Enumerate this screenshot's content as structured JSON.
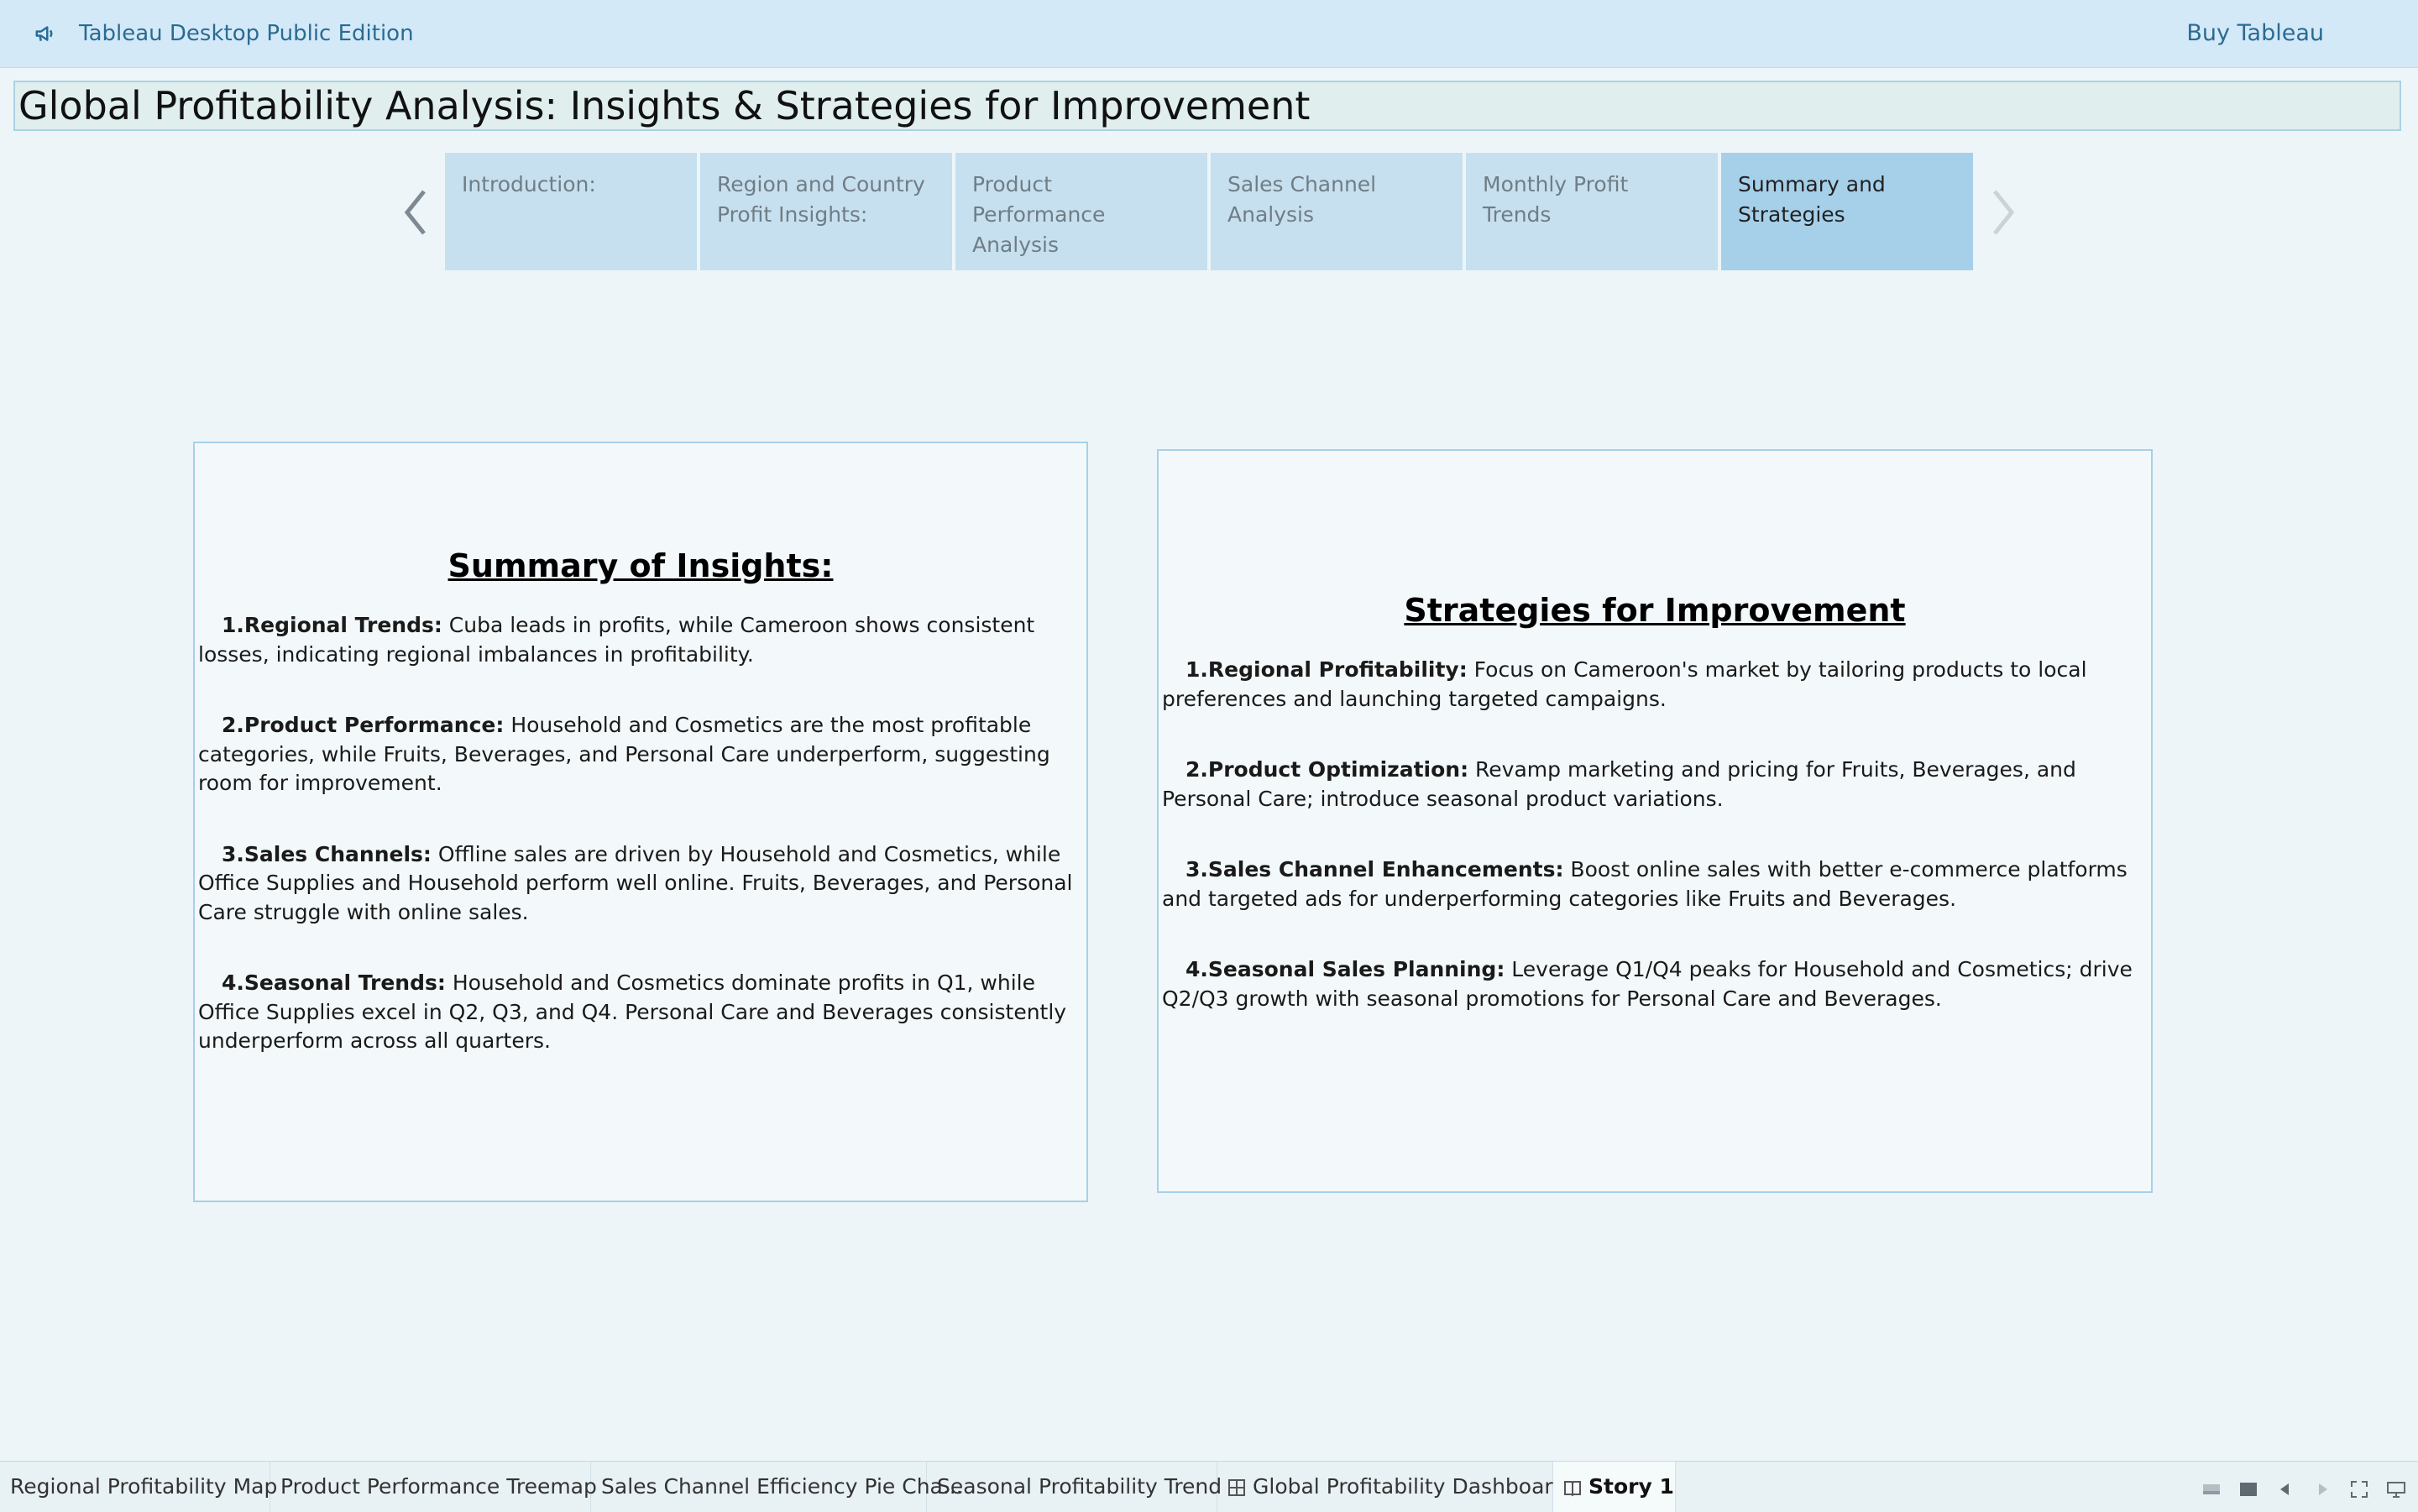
{
  "app": {
    "name": "Tableau Desktop Public Edition",
    "buy_label": "Buy Tableau",
    "megaphone_icon": "megaphone-icon"
  },
  "story": {
    "title": "Global Profitability Analysis: Insights & Strategies for Improvement",
    "points": [
      {
        "label": "Introduction:",
        "active": false
      },
      {
        "label": "Region and Country Profit Insights:",
        "active": false
      },
      {
        "label": "Product Performance Analysis",
        "active": false
      },
      {
        "label": "Sales Channel Analysis",
        "active": false
      },
      {
        "label": "Monthly Profit Trends",
        "active": false
      },
      {
        "label": "Summary and Strategies",
        "active": true
      }
    ],
    "prev_icon": "chevron-left-icon",
    "next_icon": "chevron-right-icon"
  },
  "summary": {
    "heading": "Summary of Insights:",
    "items": [
      {
        "num": "1.",
        "title": "Regional Trends:",
        "text": " Cuba leads in profits, while Cameroon shows consistent losses, indicating regional imbalances in profitability."
      },
      {
        "num": "2.",
        "title": "Product Performance:",
        "text": " Household and Cosmetics are the most profitable categories, while Fruits, Beverages, and Personal Care underperform, suggesting room for improvement."
      },
      {
        "num": "3.",
        "title": "Sales Channels:",
        "text": " Offline sales are driven by Household and Cosmetics, while Office Supplies and Household perform well online. Fruits, Beverages, and Personal Care struggle with online sales."
      },
      {
        "num": "4.",
        "title": "Seasonal Trends:",
        "text": " Household and Cosmetics dominate profits in Q1, while Office Supplies excel in Q2, Q3, and Q4. Personal Care and Beverages consistently underperform across all quarters."
      }
    ]
  },
  "strategies": {
    "heading": "Strategies for Improvement",
    "items": [
      {
        "num": "1.",
        "title": "Regional Profitability:",
        "text": " Focus on Cameroon's market by tailoring products to local preferences and launching targeted campaigns."
      },
      {
        "num": "2.",
        "title": "Product Optimization:",
        "text": " Revamp marketing and pricing for Fruits, Beverages, and Personal Care; introduce seasonal product variations."
      },
      {
        "num": "3.",
        "title": "Sales Channel Enhancements:",
        "text": " Boost online sales with better e-commerce platforms and targeted ads for underperforming categories like Fruits and Beverages."
      },
      {
        "num": "4.",
        "title": "Seasonal Sales Planning:",
        "text": " Leverage Q1/Q4 peaks for Household and Cosmetics; drive Q2/Q3 growth with seasonal promotions for Personal Care and Beverages."
      }
    ]
  },
  "tabs": [
    {
      "label": "Regional Profitability Map",
      "icon": "",
      "active": false
    },
    {
      "label": "Product Performance Treemap",
      "icon": "",
      "active": false
    },
    {
      "label": "Sales Channel Efficiency Pie Cha...",
      "icon": "",
      "active": false
    },
    {
      "label": "Seasonal Profitability Trend",
      "icon": "",
      "active": false
    },
    {
      "label": "Global Profitability Dashboard",
      "icon": "dashboard-grid-icon",
      "active": false
    },
    {
      "label": "Story 1",
      "icon": "story-book-icon",
      "active": true
    }
  ],
  "bottom_controls": [
    "show-sheet-tabs-icon",
    "show-filmstrip-icon",
    "previous-sheet-icon",
    "next-sheet-icon",
    "fullscreen-icon",
    "presentation-mode-icon"
  ],
  "colors": {
    "topbar_bg": "#d3e9f8",
    "accent_text": "#2b6b92",
    "story_point_bg": "#c6e0ef",
    "story_point_active_bg": "#a6d0ea",
    "page_bg": "#eef5f8"
  }
}
